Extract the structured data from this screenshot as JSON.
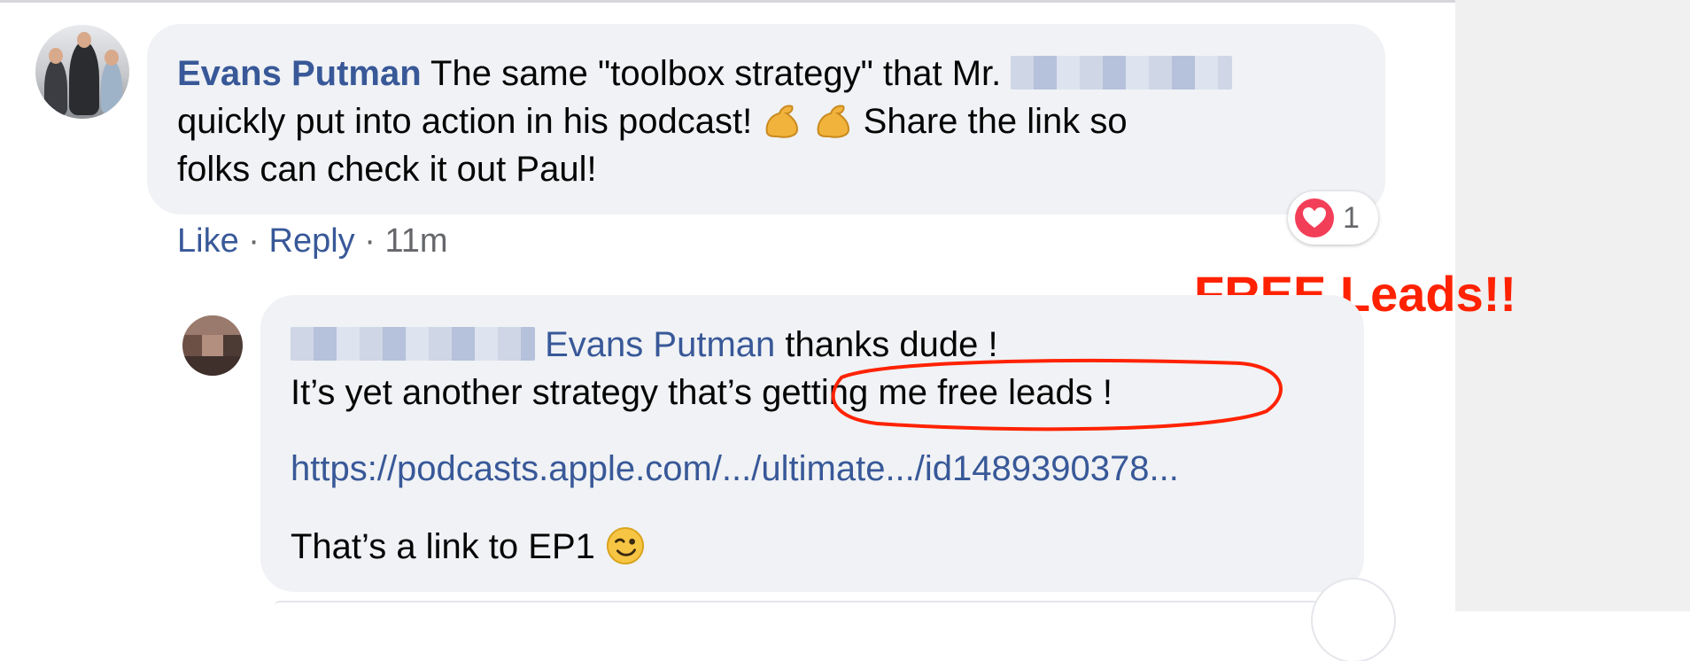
{
  "comment": {
    "author": "Evans Putman",
    "text_line1_a": "The same \"toolbox strategy\" that Mr.",
    "text_line2_a": "quickly put into action in his podcast!",
    "text_line2_b": "Share the link so",
    "text_line3": "folks can check it out Paul!",
    "like_label": "Like",
    "reply_label": "Reply",
    "separator": "·",
    "timestamp": "11m",
    "reaction_count": "1",
    "reaction_icon": "heart-icon"
  },
  "reply": {
    "mention": "Evans Putman",
    "line1_rest": "thanks dude !",
    "line2_a": "It’s yet another strategy that’s",
    "line2_b": "getting me free leads !",
    "link": "https://podcasts.apple.com/.../ultimate.../id1489390378...",
    "line4": "That’s a link to EP1"
  },
  "annotation": {
    "title": "FREE Leads!!",
    "color": "#ff2200"
  },
  "colors": {
    "link_blue": "#385898",
    "bubble_gray": "#f0f2f5",
    "heart_red": "#f33e58"
  }
}
